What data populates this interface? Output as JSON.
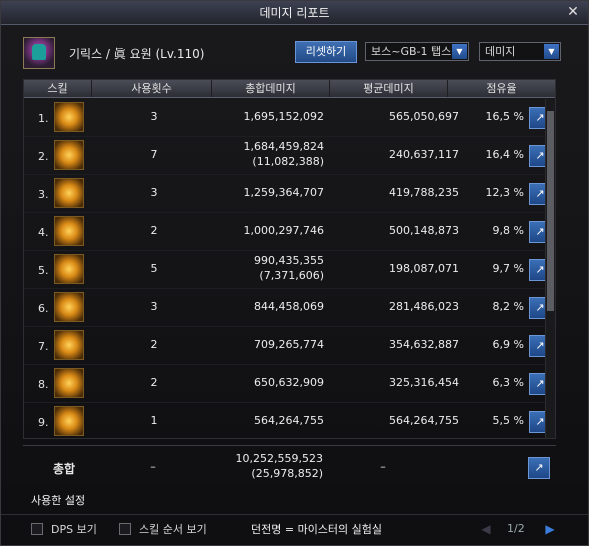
{
  "window": {
    "title": "데미지 리포트"
  },
  "header": {
    "character": "기릭스 / 眞 요원 (Lv.110)",
    "reset_label": "리셋하기",
    "boss_select": "보스~GB-1 탭스",
    "mode_select": "데미지"
  },
  "table": {
    "columns": [
      "스킬",
      "사용횟수",
      "총합데미지",
      "평균데미지",
      "점유율"
    ],
    "rows": [
      {
        "num": "1.",
        "icon": "skill-icon-1",
        "count": "3",
        "total": "1,695,152,092",
        "sub": "",
        "avg": "565,050,697",
        "share": "16,5 %"
      },
      {
        "num": "2.",
        "icon": "skill-icon-2",
        "count": "7",
        "total": "1,684,459,824",
        "sub": "(11,082,388)",
        "avg": "240,637,117",
        "share": "16,4 %"
      },
      {
        "num": "3.",
        "icon": "skill-icon-3",
        "count": "3",
        "total": "1,259,364,707",
        "sub": "",
        "avg": "419,788,235",
        "share": "12,3 %"
      },
      {
        "num": "4.",
        "icon": "skill-icon-4",
        "count": "2",
        "total": "1,000,297,746",
        "sub": "",
        "avg": "500,148,873",
        "share": "9,8 %"
      },
      {
        "num": "5.",
        "icon": "skill-icon-5",
        "count": "5",
        "total": "990,435,355",
        "sub": "(7,371,606)",
        "avg": "198,087,071",
        "share": "9,7 %"
      },
      {
        "num": "6.",
        "icon": "skill-icon-6",
        "count": "3",
        "total": "844,458,069",
        "sub": "",
        "avg": "281,486,023",
        "share": "8,2 %"
      },
      {
        "num": "7.",
        "icon": "skill-icon-7",
        "count": "2",
        "total": "709,265,774",
        "sub": "",
        "avg": "354,632,887",
        "share": "6,9 %"
      },
      {
        "num": "8.",
        "icon": "skill-icon-8",
        "count": "2",
        "total": "650,632,909",
        "sub": "",
        "avg": "325,316,454",
        "share": "6,3 %"
      },
      {
        "num": "9.",
        "icon": "skill-icon-9",
        "count": "1",
        "total": "564,264,755",
        "sub": "",
        "avg": "564,264,755",
        "share": "5,5 %"
      }
    ]
  },
  "total": {
    "label": "총합",
    "count": "–",
    "total": "10,252,559,523",
    "sub": "(25,978,852)",
    "avg": "–"
  },
  "settings_label": "사용한 설정",
  "bottom": {
    "dps_label": "DPS 보기",
    "order_label": "스킬 순서 보기",
    "dungeon": "던전명 = 마이스터의 실험실",
    "page": "1/2"
  }
}
